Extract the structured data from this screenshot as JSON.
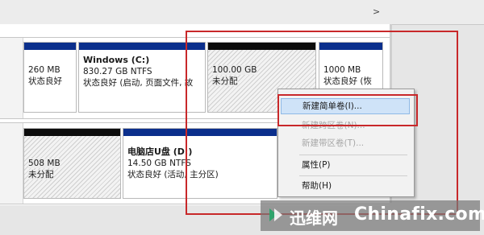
{
  "toolbar": {
    "scroll_arrow": ">"
  },
  "disk1": {
    "partitions": [
      {
        "size": "260 MB",
        "status": "状态良好"
      },
      {
        "title": "Windows  (C:)",
        "size": "830.27 GB NTFS",
        "status": "状态良好 (启动, 页面文件, 故"
      },
      {
        "size": "100.00 GB",
        "status": "未分配"
      },
      {
        "size": "1000 MB",
        "status": "状态良好 (恢"
      }
    ]
  },
  "disk2": {
    "partitions": [
      {
        "size": "508 MB",
        "status": "未分配"
      },
      {
        "title": "电脑店U盘  (D:)",
        "size": "14.50 GB NTFS",
        "status": "状态良好 (活动, 主分区)"
      }
    ]
  },
  "context_menu": {
    "items": [
      {
        "label": "新建简单卷(I)...",
        "enabled": true,
        "highlighted": true
      },
      {
        "label": "新建跨区卷(N)...",
        "enabled": false
      },
      {
        "label": "新建带区卷(T)...",
        "enabled": false
      },
      {
        "label": "属性(P)",
        "enabled": true
      },
      {
        "label": "帮助(H)",
        "enabled": true
      }
    ]
  },
  "watermark": {
    "cn": "迅维网",
    "en": "Chinafix.com"
  },
  "colors": {
    "partition_bar_primary": "#0b2f8c",
    "partition_bar_unallocated": "#0c0c0c",
    "highlight_box": "#c8282a",
    "menu_highlight": "#cfe3f8"
  }
}
